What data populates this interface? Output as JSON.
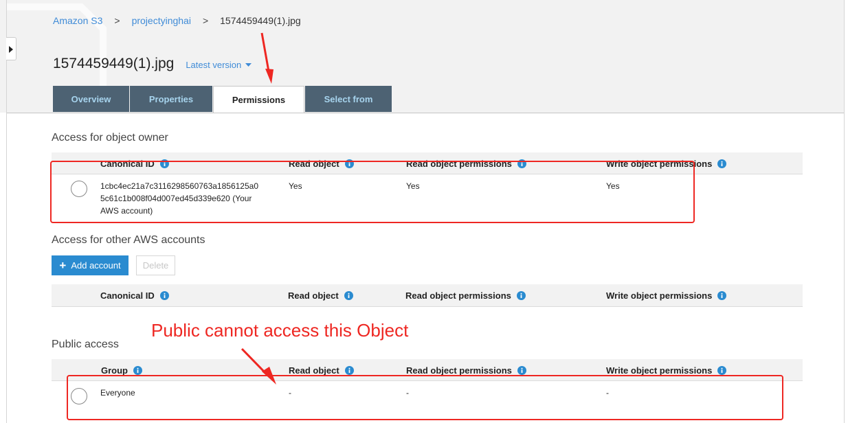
{
  "breadcrumb": {
    "items": [
      "Amazon S3",
      "projectyinghai",
      "1574459449(1).jpg"
    ],
    "separator": ">"
  },
  "object": {
    "title": "1574459449(1).jpg",
    "version_label": "Latest version"
  },
  "tabs": [
    {
      "label": "Overview",
      "active": false
    },
    {
      "label": "Properties",
      "active": false
    },
    {
      "label": "Permissions",
      "active": true
    },
    {
      "label": "Select from",
      "active": false
    }
  ],
  "owner_section": {
    "title": "Access for object owner",
    "headers": [
      "Canonical ID",
      "Read object",
      "Read object permissions",
      "Write object permissions"
    ],
    "row": {
      "id_lines": [
        "1cbc4ec21a7c3116298560763a1856125a0",
        "5c61c1b008f04d007ed45d339e620 (Your",
        "AWS account)"
      ],
      "read_object": "Yes",
      "read_permissions": "Yes",
      "write_permissions": "Yes"
    }
  },
  "other_accounts_section": {
    "title": "Access for other AWS accounts",
    "add_button": "Add account",
    "delete_button": "Delete",
    "headers": [
      "Canonical ID",
      "Read object",
      "Read object permissions",
      "Write object permissions"
    ]
  },
  "public_section": {
    "title": "Public access",
    "headers": [
      "Group",
      "Read object",
      "Read object permissions",
      "Write object permissions"
    ],
    "row": {
      "group": "Everyone",
      "read_object": "-",
      "read_permissions": "-",
      "write_permissions": "-"
    }
  },
  "annotation": {
    "text": "Public cannot access this Object",
    "color": "#ee2722"
  },
  "colors": {
    "link": "#3f8bd7",
    "tab_inactive_bg": "#4d6273",
    "tab_inactive_text": "#a7d4ee",
    "primary_button": "#2a8bd0"
  },
  "icons": {
    "info": "info-circle-icon",
    "dropdown": "caret-down-icon",
    "add": "plus-icon",
    "collapse": "chevron-right-icon"
  }
}
